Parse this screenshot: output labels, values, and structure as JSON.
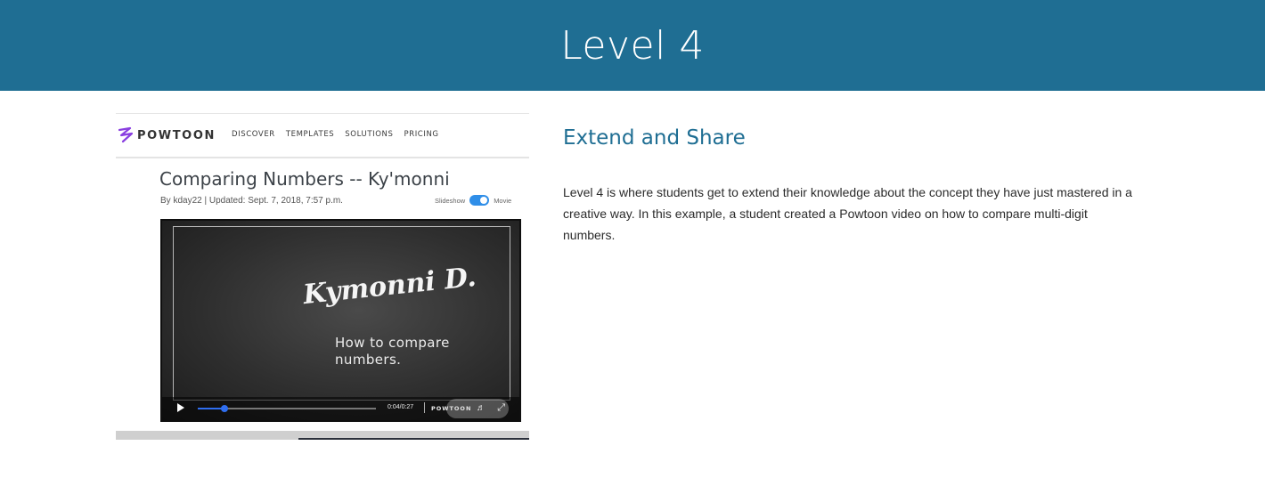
{
  "header": {
    "title": "Level 4"
  },
  "embedded_screenshot": {
    "nav": {
      "brand": "POWTOON",
      "links": [
        "DISCOVER",
        "TEMPLATES",
        "SOLUTIONS",
        "PRICING"
      ]
    },
    "title": "Comparing Numbers -- Ky'monni",
    "meta": "By kday22  |  Updated: Sept. 7, 2018, 7:57 p.m.",
    "toggle": {
      "left_label": "Slideshow",
      "right_label": "Movie",
      "on": true
    },
    "video": {
      "chalk_name": "Kymonni D.",
      "chalk_subtitle": "How to compare numbers.",
      "time": "0:04/0:27",
      "brand": "POWTOON",
      "progress": 0.15
    }
  },
  "content": {
    "heading": "Extend and Share",
    "body": "Level 4 is where students get to extend their knowledge about the concept they have just mastered in a creative way. In this example, a student created a Powtoon video on how to compare multi-digit numbers."
  },
  "colors": {
    "header_bg": "#1f6e93",
    "heading_text": "#1f6e93",
    "accent_blue": "#2f6ef0"
  }
}
